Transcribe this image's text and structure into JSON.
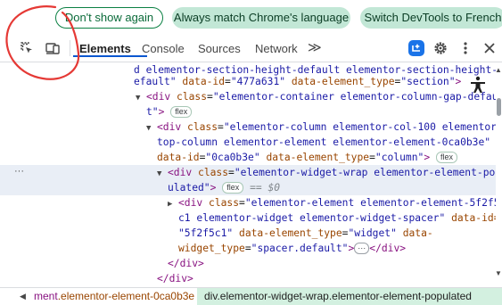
{
  "notification": {
    "dont_show_again": "Don't show again",
    "always_match": "Always match Chrome's language",
    "switch_french": "Switch DevTools to French"
  },
  "toolbar": {
    "inspect_icon": "inspect-element-icon",
    "device_icon": "device-toolbar-icon",
    "tabs": [
      "Elements",
      "Console",
      "Sources",
      "Network"
    ],
    "more_tabs": "≫",
    "active_tab": "Elements"
  },
  "dom": {
    "l1": {
      "text": "d elementor-section-height-default elementor-section-height-d"
    },
    "l2": {
      "a": "efault\"",
      "attr1": "data-id",
      "val1": "\"477a631\"",
      "attr2": "data-element_type",
      "val2": "\"section\"",
      "close": ">"
    },
    "l3": {
      "open": "<div",
      "attr": "class",
      "val": "\"elementor-container elementor-column-gap-default"
    },
    "l4": {
      "val": "t\"",
      "close": ">",
      "badge": "flex"
    },
    "l5": {
      "open": "<div",
      "attr": "class",
      "val": "\"elementor-column elementor-col-100 elementor-"
    },
    "l6": {
      "val": "top-column elementor-element elementor-element-0ca0b3e\""
    },
    "l7": {
      "attr1": "data-id",
      "val1": "\"0ca0b3e\"",
      "attr2": "data-element_type",
      "val2": "\"column\"",
      "close": ">",
      "badge": "flex"
    },
    "l8": {
      "open": "<div",
      "attr": "class",
      "val": "\"elementor-widget-wrap elementor-element-pop"
    },
    "l9": {
      "val": "ulated\"",
      "close": ">",
      "badge": "flex",
      "eq": "== $0"
    },
    "l10": {
      "open": "<div",
      "attr": "class",
      "val": "\"elementor-element elementor-element-5f2f5"
    },
    "l11": {
      "val": "c1 elementor-widget elementor-widget-spacer\"",
      "attr": "data-id="
    },
    "l12": {
      "val1": "\"5f2f5c1\"",
      "attr2": "data-element_type",
      "val2": "\"widget\"",
      "attr3": "data-"
    },
    "l13": {
      "attr": "widget_type",
      "val": "\"spacer.default\"",
      "close": ">",
      "ellipsis": "···",
      "end": "</div>"
    },
    "l14": {
      "text": "</div>"
    },
    "l15": {
      "text": "</div>"
    },
    "gutter_dots": "···"
  },
  "breadcrumbs": {
    "crumb1_prefix": "ment",
    "crumb1_class": ".elementor-element-0ca0b3e",
    "crumb2": "div.elementor-widget-wrap.elementor-element-populated"
  },
  "colors": {
    "tag": "#881280",
    "attr": "#994500",
    "value": "#1a1aa6",
    "annotation": "#e53935",
    "accent": "#0b57d0"
  }
}
